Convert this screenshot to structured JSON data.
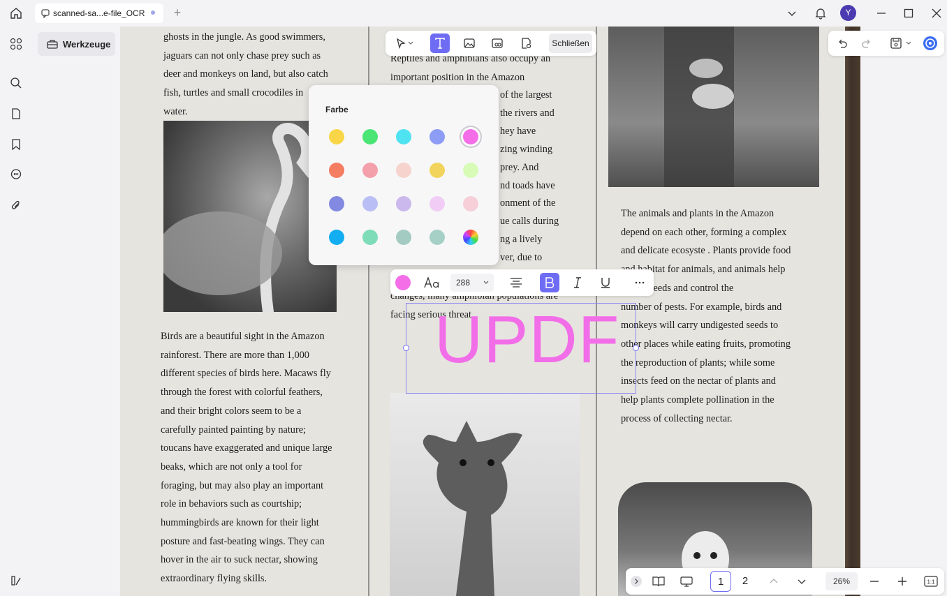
{
  "tab": {
    "title": "scanned-sa...e-file_OCR"
  },
  "user": {
    "avatar_letter": "Y"
  },
  "tools_button": {
    "label": "Werkzeuge"
  },
  "edit_toolbar": {
    "close_label": "Schließen"
  },
  "color_popup": {
    "title": "Farbe",
    "colors": [
      "#f9d648",
      "#4be576",
      "#4fe2f1",
      "#8d9cf4",
      "#f46ee8",
      "#f47d62",
      "#f4a0aa",
      "#f7d3cd",
      "#f2d45c",
      "#d8fbb8",
      "#818ae0",
      "#b9bff5",
      "#cbb8ec",
      "#f1cdf6",
      "#f7cfd8",
      "#13aef2",
      "#7edcb8",
      "#a3cbc2",
      "#a6d0c6",
      "conic"
    ],
    "selected_index": 4
  },
  "text_toolbar": {
    "font_size": "288",
    "color": "#f46ee8"
  },
  "canvas_text": {
    "value": "UPDF",
    "color": "#f26ee8"
  },
  "page_text": {
    "col1_top": [
      "ghosts in the jungle. As good swimmers,",
      "jaguars can not only chase prey such as",
      "deer and monkeys on land, but also catch",
      "fish, turtles and small crocodiles in",
      "water."
    ],
    "col1_bottom": [
      "Birds are a beautiful sight in the Amazon",
      "rainforest. There are more than 1,000",
      "different species of birds here. Macaws fly",
      "through the forest with colorful feathers,",
      "and their bright colors seem to be a",
      "carefully painted painting by nature;",
      "toucans have exaggerated and unique large",
      "beaks, which are not only a tool for",
      "foraging, but may also play an important",
      "role in behaviors such as courtship;",
      "hummingbirds are known for their light",
      "posture and fast-beating wings. They can",
      "hover in the air to suck nectar, showing",
      "extraordinary flying skills."
    ],
    "col2_top": [
      "Reptiles and amphibians also occupy an",
      "important position in the Amazon"
    ],
    "col2_fragments": [
      "of the largest",
      "the rivers and",
      "hey have",
      "zing winding",
      "prey. And",
      "nd toads have",
      "onment of the",
      "ue calls during",
      "ng a lively",
      "ver, due to"
    ],
    "col2_bottom": [
      "changes, many amphibian populations are",
      "facing serious threat"
    ],
    "col3": [
      "The animals and plants in the Amazon",
      "depend on each other, forming a complex",
      "and delicate ecosyste  . Plants provide food",
      "and habitat for animals, and animals help",
      "spread seeds and control the",
      "number of pests. For example, birds and",
      "monkeys will carry undigested seeds to",
      "other places while eating fruits, promoting",
      "the reproduction of plants; while some",
      "insects feed on the nectar of plants and",
      "help plants complete pollination in the",
      "process of collecting nectar."
    ]
  },
  "pagination": {
    "pages": [
      "1",
      "2"
    ],
    "current": "1",
    "zoom": "26%",
    "fit_label": "1:1"
  },
  "accent": "#6f6cf4"
}
